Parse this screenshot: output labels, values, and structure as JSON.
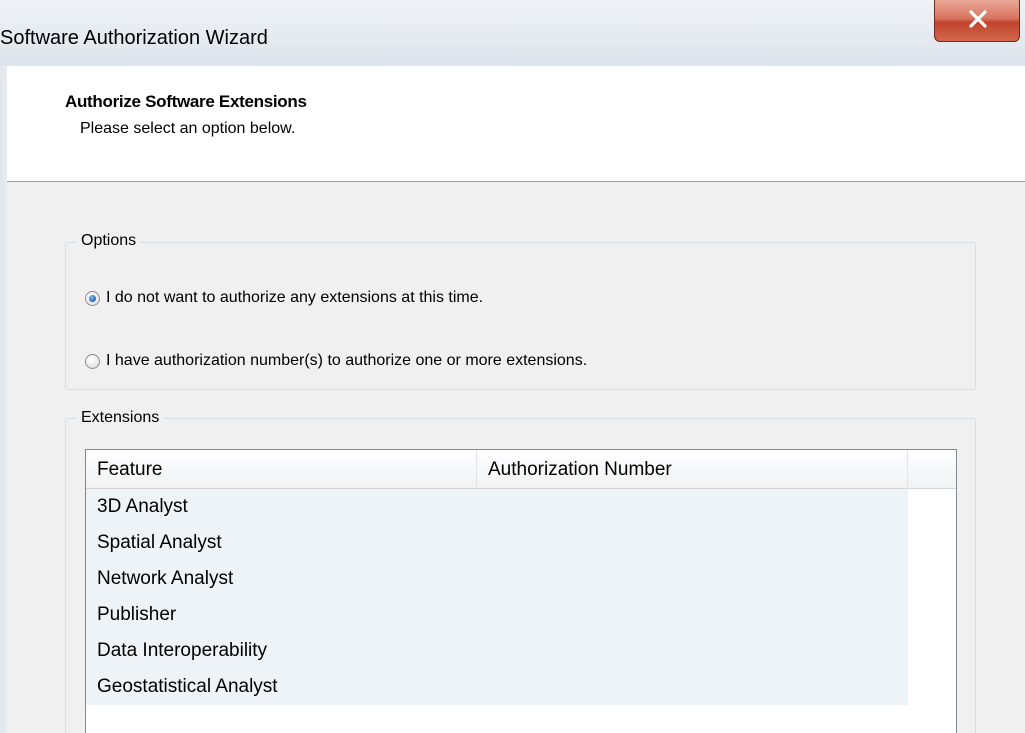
{
  "window": {
    "title": "Software Authorization Wizard"
  },
  "icons": {
    "close": "close-icon"
  },
  "colors": {
    "close_button": "#c7462f",
    "radio_selected": "#2b6fb8",
    "header_background": "#ffffff",
    "dialog_background": "#f0f0f0",
    "row_background": "#eef3f8"
  },
  "header": {
    "title": "Authorize Software Extensions",
    "subtitle": "Please select an option below."
  },
  "options": {
    "label": "Options",
    "items": [
      {
        "label": "I do not want to authorize any extensions at this time.",
        "selected": true
      },
      {
        "label": "I have authorization number(s) to authorize one or more extensions.",
        "selected": false
      }
    ]
  },
  "extensions": {
    "label": "Extensions",
    "columns": [
      "Feature",
      "Authorization Number",
      ""
    ],
    "rows": [
      {
        "feature": "3D Analyst",
        "authorization_number": ""
      },
      {
        "feature": "Spatial Analyst",
        "authorization_number": ""
      },
      {
        "feature": "Network Analyst",
        "authorization_number": ""
      },
      {
        "feature": "Publisher",
        "authorization_number": ""
      },
      {
        "feature": "Data Interoperability",
        "authorization_number": ""
      },
      {
        "feature": "Geostatistical Analyst",
        "authorization_number": ""
      }
    ]
  }
}
